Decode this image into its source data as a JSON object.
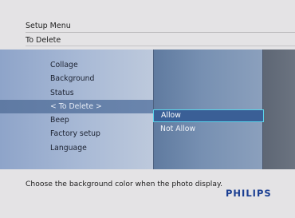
{
  "header": {
    "menu_title": "Setup Menu",
    "breadcrumb": "To Delete"
  },
  "menu": {
    "items": [
      {
        "label": "Collage",
        "active": false
      },
      {
        "label": "Background",
        "active": false
      },
      {
        "label": "Status",
        "active": false
      },
      {
        "label": "< To Delete >",
        "active": true
      },
      {
        "label": "Beep",
        "active": false
      },
      {
        "label": "Factory setup",
        "active": false
      },
      {
        "label": "Language",
        "active": false
      }
    ]
  },
  "submenu": {
    "options": [
      {
        "label": "Allow",
        "selected": true
      },
      {
        "label": "Not Allow",
        "selected": false
      }
    ]
  },
  "footer": {
    "help_text": "Choose the background color when the photo display.",
    "brand": "PHILIPS"
  },
  "colors": {
    "brand": "#1a3e92",
    "selection_border": "#5bd4ea",
    "selection_fill": "#3a5f96",
    "active_menu": "#6a85ad"
  }
}
